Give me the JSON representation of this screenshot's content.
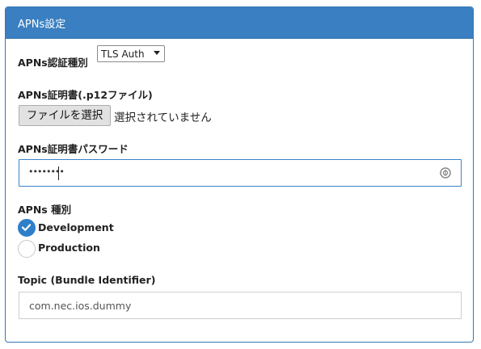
{
  "panel": {
    "title": "APNs設定"
  },
  "auth_type": {
    "label": "APNs認証種別",
    "selected": "TLS Auth"
  },
  "certificate": {
    "label": "APNs証明書(.p12ファイル)",
    "button_label": "ファイルを選択",
    "status": "選択されていません"
  },
  "password": {
    "label": "APNs証明書パスワード",
    "masked_value": "••••••••"
  },
  "apns_type": {
    "label": "APNs 種別",
    "options": [
      {
        "label": "Development",
        "checked": true
      },
      {
        "label": "Production",
        "checked": false
      }
    ]
  },
  "topic": {
    "label": "Topic (Bundle Identifier)",
    "value": "com.nec.ios.dummy"
  },
  "colors": {
    "header_bg": "#3a7fc1",
    "radio_checked": "#2f7fc8",
    "focus_border": "#3b83c9"
  }
}
